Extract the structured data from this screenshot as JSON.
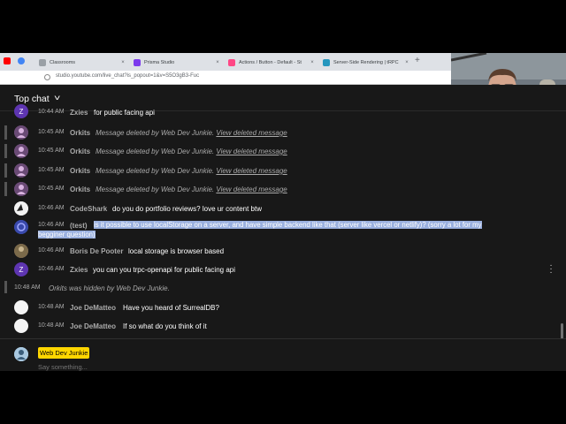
{
  "browser": {
    "tabs": [
      {
        "title": "Classrooms",
        "favicon_color": "#9aa0a6",
        "active": false
      },
      {
        "title": "Prisma Studio",
        "favicon_color": "#7c3aed",
        "active": false
      },
      {
        "title": "Actions / Button - Default - St",
        "favicon_color": "#ff4785",
        "active": false
      },
      {
        "title": "Server-Side Rendering | tRPC",
        "favicon_color": "#2596be",
        "active": false
      }
    ],
    "new_tab": "+",
    "url": "studio.youtube.com/live_chat?is_popout=1&v=S5O3gB3-Fuc"
  },
  "chat": {
    "header_title": "Top chat",
    "messages": [
      {
        "time": "10:44 AM",
        "author": "Zxies",
        "text": "for public facing api",
        "avatar_color": "#5e35b1",
        "avatar_letter": "Z"
      },
      {
        "time": "10:45 AM",
        "author": "Orkits",
        "deleted": "Message deleted by Web Dev Junkie.",
        "link": "View deleted message",
        "avatar_color": "#7d5a86"
      },
      {
        "time": "10:45 AM",
        "author": "Orkits",
        "deleted": "Message deleted by Web Dev Junkie.",
        "link": "View deleted message",
        "avatar_color": "#7d5a86"
      },
      {
        "time": "10:45 AM",
        "author": "Orkits",
        "deleted": "Message deleted by Web Dev Junkie.",
        "link": "View deleted message",
        "avatar_color": "#7d5a86"
      },
      {
        "time": "10:45 AM",
        "author": "Orkits",
        "deleted": "Message deleted by Web Dev Junkie.",
        "link": "View deleted message",
        "avatar_color": "#7d5a86"
      },
      {
        "time": "10:46 AM",
        "author": "CodeShark",
        "text": "do you do portfolio reviews? love ur content btw",
        "avatar_color": "#e0e0e0"
      },
      {
        "time": "10:46 AM",
        "author": "(test)",
        "text": "is it possible to use localStorage on a server, and have simple backend like that (server like vercel or netlify)? (sorry a lot for my",
        "text2": "begginer question)",
        "avatar_color": "#3f51b5"
      },
      {
        "time": "10:46 AM",
        "author": "Boris De Pooter",
        "text": "local storage is browser based",
        "avatar_color": "#8d6e63"
      },
      {
        "time": "10:46 AM",
        "author": "Zxies",
        "text": "you can you trpc-openapi for public facing api",
        "avatar_color": "#5e35b1",
        "avatar_letter": "Z"
      },
      {
        "time": "10:48 AM",
        "notice": "Orkits was hidden by Web Dev Junkie."
      },
      {
        "time": "10:48 AM",
        "author": "Joe DeMatteo",
        "text": "Have you heard of SurrealDB?",
        "avatar_color": "#f5f5f5"
      },
      {
        "time": "10:48 AM",
        "author": "Joe DeMatteo",
        "text": "If so what do you think of it",
        "avatar_color": "#f5f5f5"
      }
    ],
    "input": {
      "user": "Web Dev Junkie",
      "placeholder": "Say something..."
    }
  }
}
